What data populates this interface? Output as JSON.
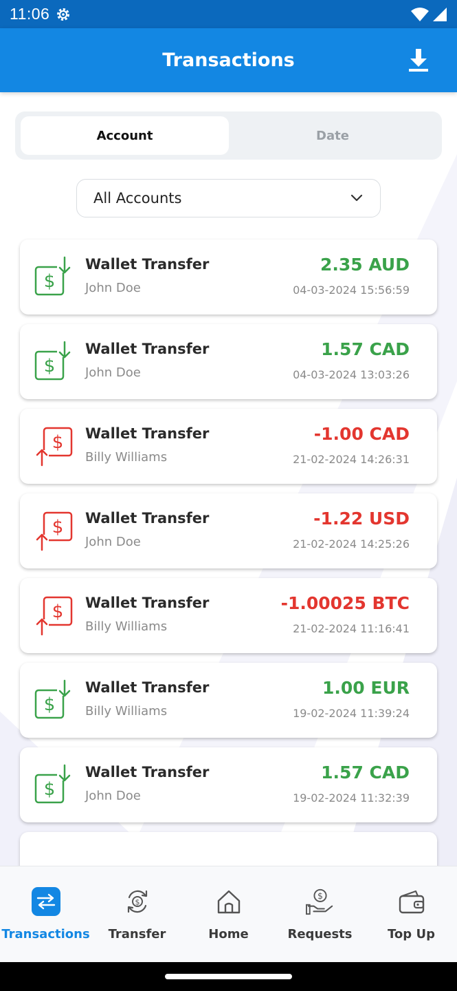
{
  "status_bar": {
    "time": "11:06"
  },
  "header": {
    "title": "Transactions"
  },
  "segment": {
    "tabs": [
      {
        "label": "Account"
      },
      {
        "label": "Date"
      }
    ]
  },
  "account_filter": {
    "value": "All Accounts"
  },
  "transactions": [
    {
      "title": "Wallet Transfer",
      "name": "John Doe",
      "amount": "2.35 AUD",
      "date": "04-03-2024 15:56:59",
      "direction": "incoming"
    },
    {
      "title": "Wallet Transfer",
      "name": "John Doe",
      "amount": "1.57 CAD",
      "date": "04-03-2024 13:03:26",
      "direction": "incoming"
    },
    {
      "title": "Wallet Transfer",
      "name": "Billy Williams",
      "amount": "-1.00 CAD",
      "date": "21-02-2024 14:26:31",
      "direction": "outgoing"
    },
    {
      "title": "Wallet Transfer",
      "name": "John Doe",
      "amount": "-1.22 USD",
      "date": "21-02-2024 14:25:26",
      "direction": "outgoing"
    },
    {
      "title": "Wallet Transfer",
      "name": "Billy Williams",
      "amount": "-1.00025 BTC",
      "date": "21-02-2024 11:16:41",
      "direction": "outgoing"
    },
    {
      "title": "Wallet Transfer",
      "name": "Billy Williams",
      "amount": "1.00 EUR",
      "date": "19-02-2024 11:39:24",
      "direction": "incoming"
    },
    {
      "title": "Wallet Transfer",
      "name": "John Doe",
      "amount": "1.57 CAD",
      "date": "19-02-2024 11:32:39",
      "direction": "incoming"
    }
  ],
  "bottom_nav": [
    {
      "label": "Transactions",
      "icon": "transactions-icon",
      "active": true
    },
    {
      "label": "Transfer",
      "icon": "transfer-icon",
      "active": false
    },
    {
      "label": "Home",
      "icon": "home-icon",
      "active": false
    },
    {
      "label": "Requests",
      "icon": "requests-icon",
      "active": false
    },
    {
      "label": "Top Up",
      "icon": "wallet-icon",
      "active": false
    }
  ],
  "colors": {
    "primary": "#1387e3",
    "status_bar": "#0b69bd",
    "positive": "#3aa24a",
    "negative": "#e3362f"
  }
}
